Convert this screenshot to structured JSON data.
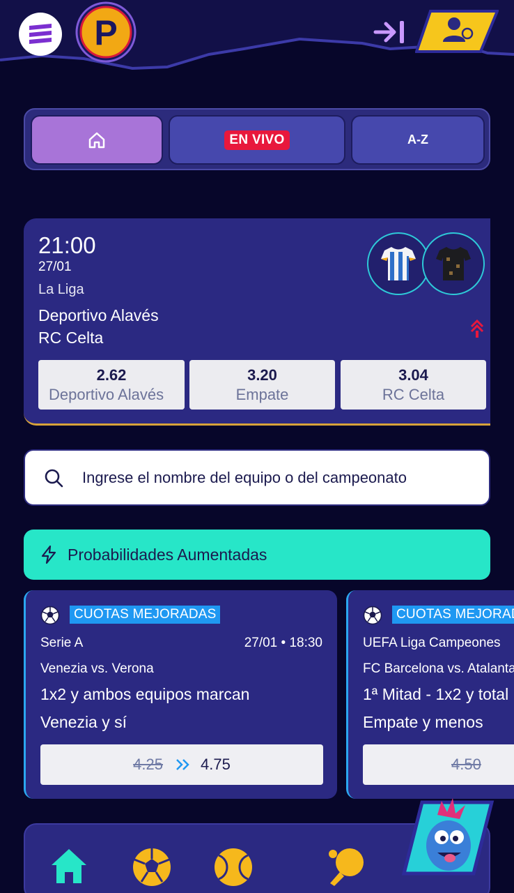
{
  "header": {
    "menu_icon": "hamburger-menu-icon",
    "logo_letter": "P",
    "login_icon": "login-arrow-icon",
    "register_icon": "add-user-icon"
  },
  "tabs": {
    "home_icon": "home-icon",
    "live_label": "EN VIVO",
    "az_label": "A-Z"
  },
  "featured_match": {
    "time": "21:00",
    "date": "27/01",
    "league": "La Liga",
    "home_team": "Deportivo Alavés",
    "away_team": "RC Celta",
    "odds": [
      {
        "value": "2.62",
        "label": "Deportivo Alavés"
      },
      {
        "value": "3.20",
        "label": "Empate"
      },
      {
        "value": "3.04",
        "label": "RC Celta"
      }
    ]
  },
  "search": {
    "placeholder": "Ingrese el nombre del equipo o del campeonato"
  },
  "boosted": {
    "title": "Probabilidades Aumentadas"
  },
  "promos": [
    {
      "badge": "CUOTAS MEJORADAS",
      "league": "Serie A",
      "datetime": "27/01 • 18:30",
      "match": "Venezia vs. Verona",
      "market": "1x2 y ambos equipos marcan",
      "selection": "Venezia y sí",
      "old_odds": "4.25",
      "new_odds": "4.75"
    },
    {
      "badge": "CUOTAS MEJORADAS",
      "league": "UEFA Liga Campeones",
      "match": "FC Barcelona vs. Atalanta",
      "market": "1ª Mitad - 1x2 y total",
      "selection": "Empate y menos",
      "old_odds": "4.50"
    }
  ],
  "bottom_nav": {
    "items": [
      "home-icon",
      "soccer-ball-icon",
      "tennis-ball-icon",
      "table-tennis-icon"
    ]
  },
  "colors": {
    "background": "#07062a",
    "card": "#2b2982",
    "accent_purple": "#a874d8",
    "live_red": "#e8183c",
    "teal": "#27e6c8",
    "badge_blue": "#1f98f2",
    "register_yellow": "#f6c61c"
  }
}
